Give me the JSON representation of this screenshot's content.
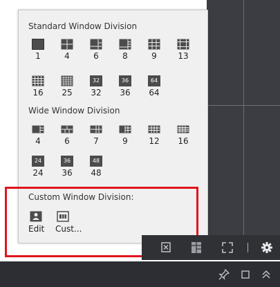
{
  "popup": {
    "standard": {
      "title": "Standard Window Division",
      "items": [
        {
          "label": "1",
          "icon": "layout-1-icon"
        },
        {
          "label": "4",
          "icon": "layout-4-icon"
        },
        {
          "label": "6",
          "icon": "layout-6-icon"
        },
        {
          "label": "8",
          "icon": "layout-8-icon"
        },
        {
          "label": "9",
          "icon": "layout-9-icon"
        },
        {
          "label": "13",
          "icon": "layout-13-icon"
        },
        {
          "label": "16",
          "icon": "layout-16-icon"
        },
        {
          "label": "25",
          "icon": "layout-25-icon"
        },
        {
          "label": "32",
          "icon": "layout-32-icon",
          "badge": "32"
        },
        {
          "label": "36",
          "icon": "layout-36-icon",
          "badge": "36"
        },
        {
          "label": "64",
          "icon": "layout-64-icon",
          "badge": "64"
        }
      ]
    },
    "wide": {
      "title": "Wide Window Division",
      "items": [
        {
          "label": "4",
          "icon": "wide-layout-4-icon"
        },
        {
          "label": "6",
          "icon": "wide-layout-6-icon"
        },
        {
          "label": "7",
          "icon": "wide-layout-7-icon"
        },
        {
          "label": "9",
          "icon": "wide-layout-9-icon"
        },
        {
          "label": "12",
          "icon": "wide-layout-12-icon"
        },
        {
          "label": "16",
          "icon": "wide-layout-16-icon"
        },
        {
          "label": "24",
          "icon": "wide-layout-24-icon",
          "badge": "24"
        },
        {
          "label": "36",
          "icon": "wide-layout-36-icon",
          "badge": "36"
        },
        {
          "label": "48",
          "icon": "wide-layout-48-icon",
          "badge": "48"
        }
      ]
    },
    "custom": {
      "title": "Custom Window Division:",
      "edit_label": "Edit",
      "custom_label": "Cust..."
    }
  },
  "toolbar": {
    "icons": [
      "close-all-windows-icon",
      "window-division-icon",
      "fullscreen-icon",
      "settings-icon"
    ]
  },
  "bottom_bar": {
    "icons": [
      "pin-icon",
      "restore-icon",
      "collapse-up-icon"
    ]
  },
  "colors": {
    "highlight": "#e0141b",
    "popup_bg": "#f0f0f0",
    "toolbar_bg": "#2f3135",
    "icon_dark": "#4c4c4c"
  }
}
